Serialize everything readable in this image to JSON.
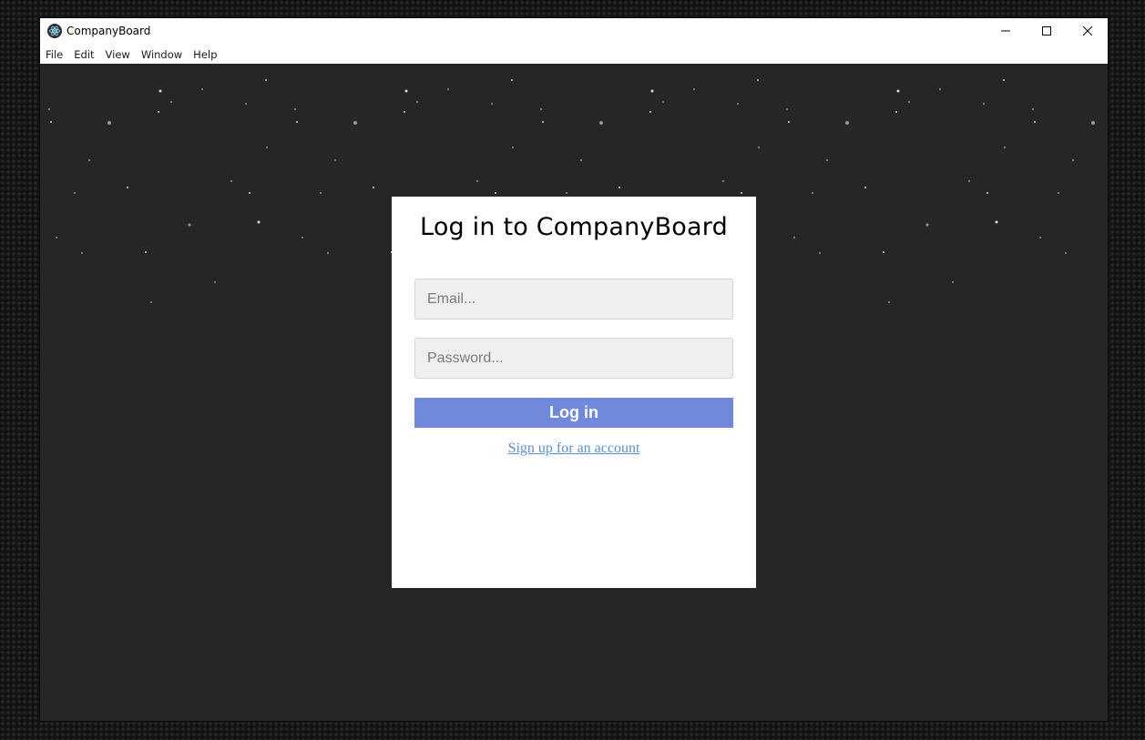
{
  "window": {
    "title": "CompanyBoard",
    "menu": [
      "File",
      "Edit",
      "View",
      "Window",
      "Help"
    ],
    "controls": [
      "minimize",
      "maximize",
      "close"
    ]
  },
  "login": {
    "heading": "Log in to CompanyBoard",
    "email_placeholder": "Email...",
    "password_placeholder": "Password...",
    "submit_label": "Log in",
    "signup_link": "Sign up for an account"
  },
  "colors": {
    "accent": "#7189db",
    "link": "#5b8fd6",
    "background": "#262626",
    "input_bg": "#eeeff0"
  },
  "icons": {
    "app": "electron-atom-icon",
    "minimize": "minimize-icon",
    "maximize": "maximize-icon",
    "close": "close-icon"
  }
}
